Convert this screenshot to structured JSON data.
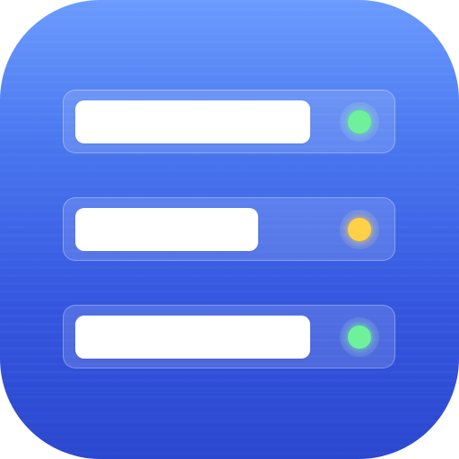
{
  "rows": [
    {
      "status": "online",
      "status_color": "#5ef08f",
      "bar_fill": 1.0
    },
    {
      "status": "warning",
      "status_color": "#ffcc33",
      "bar_fill": 0.78
    },
    {
      "status": "online",
      "status_color": "#5ef08f",
      "bar_fill": 1.0
    }
  ],
  "colors": {
    "background_top": "#6b9bff",
    "background_bottom": "#2a47cf",
    "bar": "#ffffff"
  },
  "icon": "server-list-icon"
}
